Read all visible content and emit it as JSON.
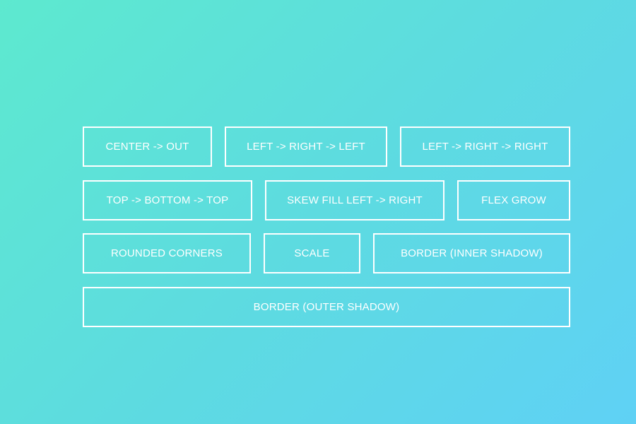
{
  "colors": {
    "gradient_start": "#5de9cf",
    "gradient_end": "#5fd1f5",
    "button_border": "#ffffff",
    "button_text": "#ffffff"
  },
  "buttons": [
    {
      "label": "CENTER -> OUT"
    },
    {
      "label": "LEFT -> RIGHT -> LEFT"
    },
    {
      "label": "LEFT -> RIGHT -> RIGHT"
    },
    {
      "label": "TOP -> BOTTOM -> TOP"
    },
    {
      "label": "SKEW FILL LEFT -> RIGHT"
    },
    {
      "label": "FLEX GROW"
    },
    {
      "label": "ROUNDED CORNERS"
    },
    {
      "label": "SCALE"
    },
    {
      "label": "BORDER (INNER SHADOW)"
    },
    {
      "label": "BORDER (OUTER SHADOW)"
    }
  ]
}
